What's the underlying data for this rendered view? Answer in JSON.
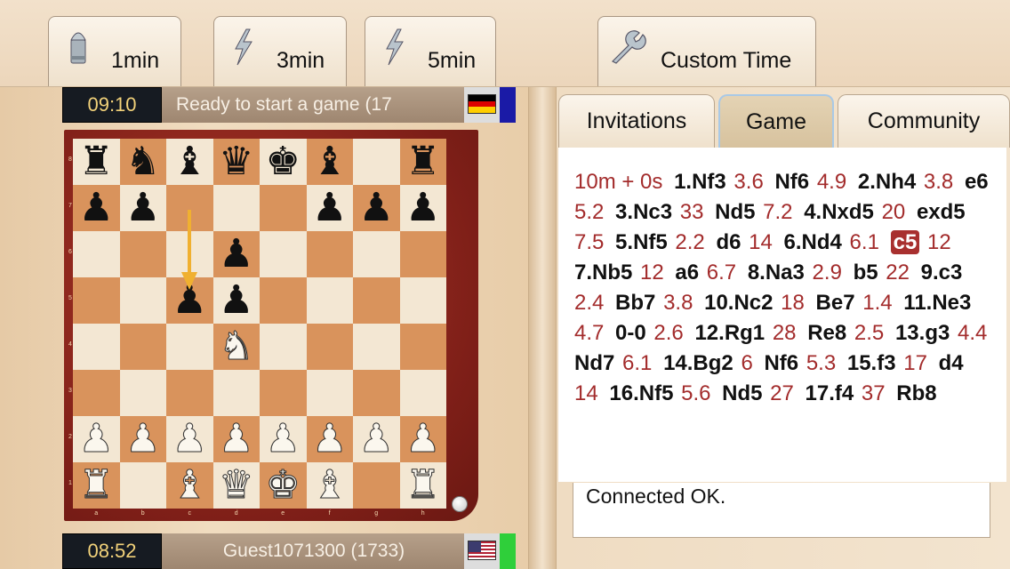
{
  "toolbar": {
    "buttons": [
      {
        "label": "1min",
        "icon": "bullet-icon"
      },
      {
        "label": "3min",
        "icon": "lightning-icon"
      },
      {
        "label": "5min",
        "icon": "lightning-icon"
      },
      {
        "label": "Custom Time",
        "icon": "wrench-icon"
      }
    ]
  },
  "opponent": {
    "clock": "09:10",
    "name": "Ready to start a game (17",
    "flag": "germany-flag",
    "indicator_color": "#1a1aa6"
  },
  "player": {
    "clock": "08:52",
    "name": "Guest1071300 (1733)",
    "flag": "usa-flag",
    "indicator_color": "#2fcf3a"
  },
  "board": {
    "ranks": [
      "8",
      "7",
      "6",
      "5",
      "4",
      "3",
      "2",
      "1"
    ],
    "files": [
      "a",
      "b",
      "c",
      "d",
      "e",
      "f",
      "g",
      "h"
    ],
    "position": [
      [
        "br",
        "bn",
        "bb",
        "bq",
        "bk",
        "bb",
        "",
        "br"
      ],
      [
        "bp",
        "bp",
        "",
        "",
        "",
        "bp",
        "bp",
        "bp"
      ],
      [
        "",
        "",
        "",
        "bp",
        "",
        "",
        "",
        ""
      ],
      [
        "",
        "",
        "bp",
        "bp",
        "",
        "",
        "",
        ""
      ],
      [
        "",
        "",
        "",
        "wn",
        "",
        "",
        "",
        ""
      ],
      [
        "",
        "",
        "",
        "",
        "",
        "",
        "",
        ""
      ],
      [
        "wp",
        "wp",
        "wp",
        "wp",
        "wp",
        "wp",
        "wp",
        "wp"
      ],
      [
        "wr",
        "",
        "wb",
        "wq",
        "wk",
        "wb",
        "",
        "wr"
      ]
    ],
    "last_move": {
      "from": "c7",
      "to": "c5"
    },
    "colors": {
      "light": "#f3e7d3",
      "dark": "#d9935c",
      "arrow": "#f0b030"
    }
  },
  "tabs": [
    {
      "label": "Invitations",
      "active": false
    },
    {
      "label": "Game",
      "active": true
    },
    {
      "label": "Community",
      "active": false
    }
  ],
  "moves": [
    {
      "t": "time",
      "v": "10m + 0s"
    },
    {
      "t": "move",
      "v": "1.Nf3"
    },
    {
      "t": "time",
      "v": "3.6"
    },
    {
      "t": "move",
      "v": "Nf6"
    },
    {
      "t": "time",
      "v": "4.9"
    },
    {
      "t": "move",
      "v": "2.Nh4"
    },
    {
      "t": "time",
      "v": "3.8"
    },
    {
      "t": "move",
      "v": "e6"
    },
    {
      "t": "time",
      "v": "5.2"
    },
    {
      "t": "move",
      "v": "3.Nc3"
    },
    {
      "t": "time",
      "v": "33"
    },
    {
      "t": "move",
      "v": "Nd5"
    },
    {
      "t": "time",
      "v": "7.2"
    },
    {
      "t": "move",
      "v": "4.Nxd5"
    },
    {
      "t": "time",
      "v": "20"
    },
    {
      "t": "move",
      "v": "exd5"
    },
    {
      "t": "time",
      "v": "7.5"
    },
    {
      "t": "move",
      "v": "5.Nf5"
    },
    {
      "t": "time",
      "v": "2.2"
    },
    {
      "t": "move",
      "v": "d6"
    },
    {
      "t": "time",
      "v": "14"
    },
    {
      "t": "move",
      "v": "6.Nd4"
    },
    {
      "t": "time",
      "v": "6.1"
    },
    {
      "t": "move",
      "v": "c5",
      "hl": true
    },
    {
      "t": "time",
      "v": "12"
    },
    {
      "t": "move",
      "v": "7.Nb5"
    },
    {
      "t": "time",
      "v": "12"
    },
    {
      "t": "move",
      "v": "a6"
    },
    {
      "t": "time",
      "v": "6.7"
    },
    {
      "t": "move",
      "v": "8.Na3"
    },
    {
      "t": "time",
      "v": "2.9"
    },
    {
      "t": "move",
      "v": "b5"
    },
    {
      "t": "time",
      "v": "22"
    },
    {
      "t": "move",
      "v": "9.c3"
    },
    {
      "t": "time",
      "v": "2.4"
    },
    {
      "t": "move",
      "v": "Bb7"
    },
    {
      "t": "time",
      "v": "3.8"
    },
    {
      "t": "move",
      "v": "10.Nc2"
    },
    {
      "t": "time",
      "v": "18"
    },
    {
      "t": "move",
      "v": "Be7"
    },
    {
      "t": "time",
      "v": "1.4"
    },
    {
      "t": "move",
      "v": "11.Ne3"
    },
    {
      "t": "time",
      "v": "4.7"
    },
    {
      "t": "move",
      "v": "0-0"
    },
    {
      "t": "time",
      "v": "2.6"
    },
    {
      "t": "move",
      "v": "12.Rg1"
    },
    {
      "t": "time",
      "v": "28"
    },
    {
      "t": "move",
      "v": "Re8"
    },
    {
      "t": "time",
      "v": "2.5"
    },
    {
      "t": "move",
      "v": "13.g3"
    },
    {
      "t": "time",
      "v": "4.4"
    },
    {
      "t": "move",
      "v": "Nd7"
    },
    {
      "t": "time",
      "v": "6.1"
    },
    {
      "t": "move",
      "v": "14.Bg2"
    },
    {
      "t": "time",
      "v": "6"
    },
    {
      "t": "move",
      "v": "Nf6"
    },
    {
      "t": "time",
      "v": "5.3"
    },
    {
      "t": "move",
      "v": "15.f3"
    },
    {
      "t": "time",
      "v": "17"
    },
    {
      "t": "move",
      "v": "d4"
    },
    {
      "t": "time",
      "v": "14"
    },
    {
      "t": "move",
      "v": "16.Nf5"
    },
    {
      "t": "time",
      "v": "5.6"
    },
    {
      "t": "move",
      "v": "Nd5"
    },
    {
      "t": "time",
      "v": "27"
    },
    {
      "t": "move",
      "v": "17.f4"
    },
    {
      "t": "time",
      "v": "37"
    },
    {
      "t": "move",
      "v": "Rb8"
    }
  ],
  "status": {
    "text": "Connected OK."
  }
}
